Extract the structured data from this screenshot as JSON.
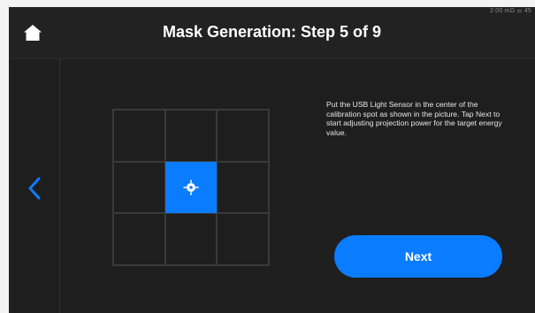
{
  "status_bar": {
    "text": "2:00 mΩ ⚌ 45"
  },
  "header": {
    "title": "Mask Generation: Step 5 of 9",
    "home_icon": "home-icon"
  },
  "nav": {
    "back_icon": "chevron-left-icon"
  },
  "calibration_grid": {
    "rows": 3,
    "cols": 3,
    "active_cell": "center",
    "active_icon": "crosshair-target-icon",
    "accent_color": "#0a7cff"
  },
  "instructions": {
    "text": "Put the USB Light Sensor in the center of the calibration spot as shown in the picture. Tap Next to start adjusting projection power for the target energy value."
  },
  "actions": {
    "next_label": "Next"
  }
}
